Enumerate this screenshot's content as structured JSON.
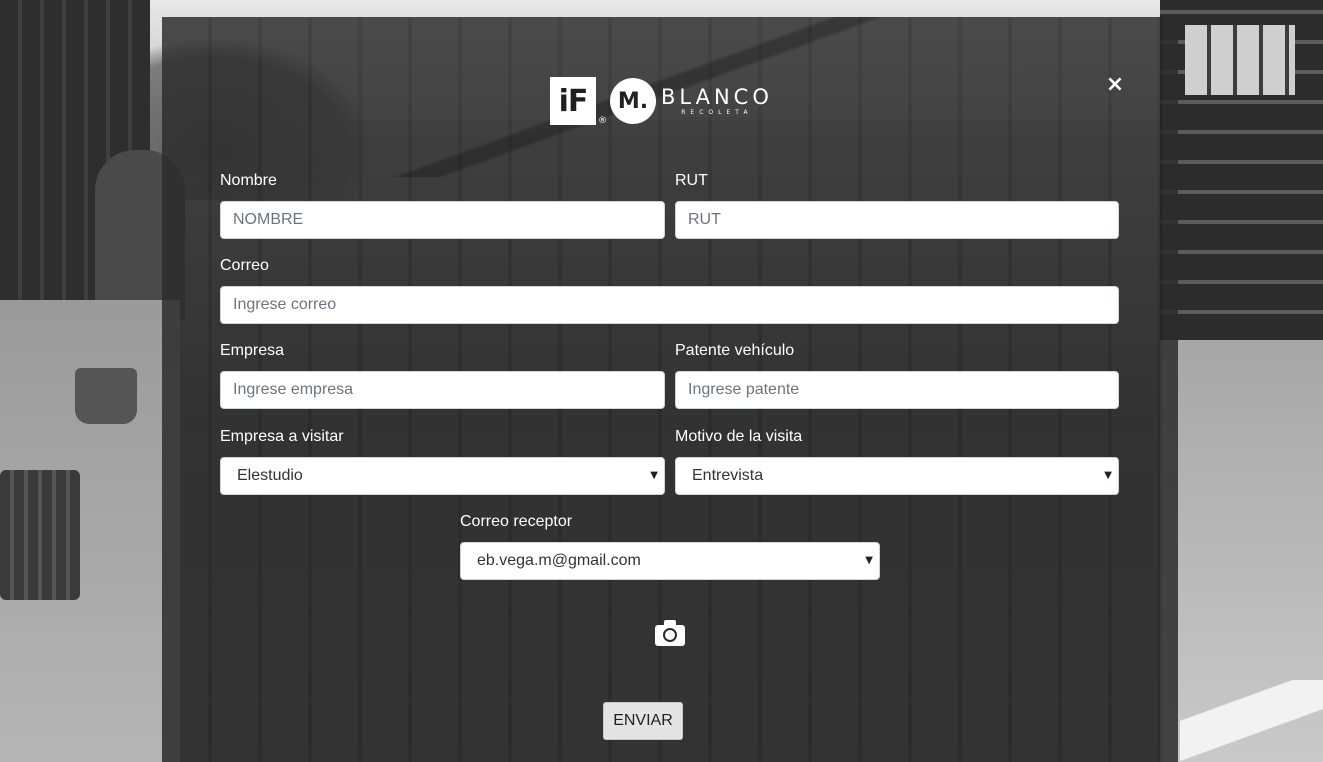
{
  "header": {
    "logo_if": "iF",
    "logo_reg": "®",
    "logo_m": "M.",
    "logo_name": "BLANCO",
    "logo_sub": "RECOLETA",
    "close_label": "×"
  },
  "form": {
    "nombre": {
      "label": "Nombre",
      "placeholder": "NOMBRE"
    },
    "rut": {
      "label": "RUT",
      "placeholder": "RUT"
    },
    "correo": {
      "label": "Correo",
      "placeholder": "Ingrese correo"
    },
    "empresa": {
      "label": "Empresa",
      "placeholder": "Ingrese empresa"
    },
    "patente": {
      "label": "Patente vehículo",
      "placeholder": "Ingrese patente"
    },
    "empresa_visitar": {
      "label": "Empresa a visitar",
      "value": "Elestudio"
    },
    "motivo": {
      "label": "Motivo de la visita",
      "value": "Entrevista"
    },
    "correo_receptor": {
      "label": "Correo receptor",
      "value": "eb.vega.m@gmail.com"
    },
    "caret": "▼",
    "submit_label": "ENVIAR"
  },
  "icons": {
    "camera": "camera-icon",
    "close": "close-icon"
  }
}
